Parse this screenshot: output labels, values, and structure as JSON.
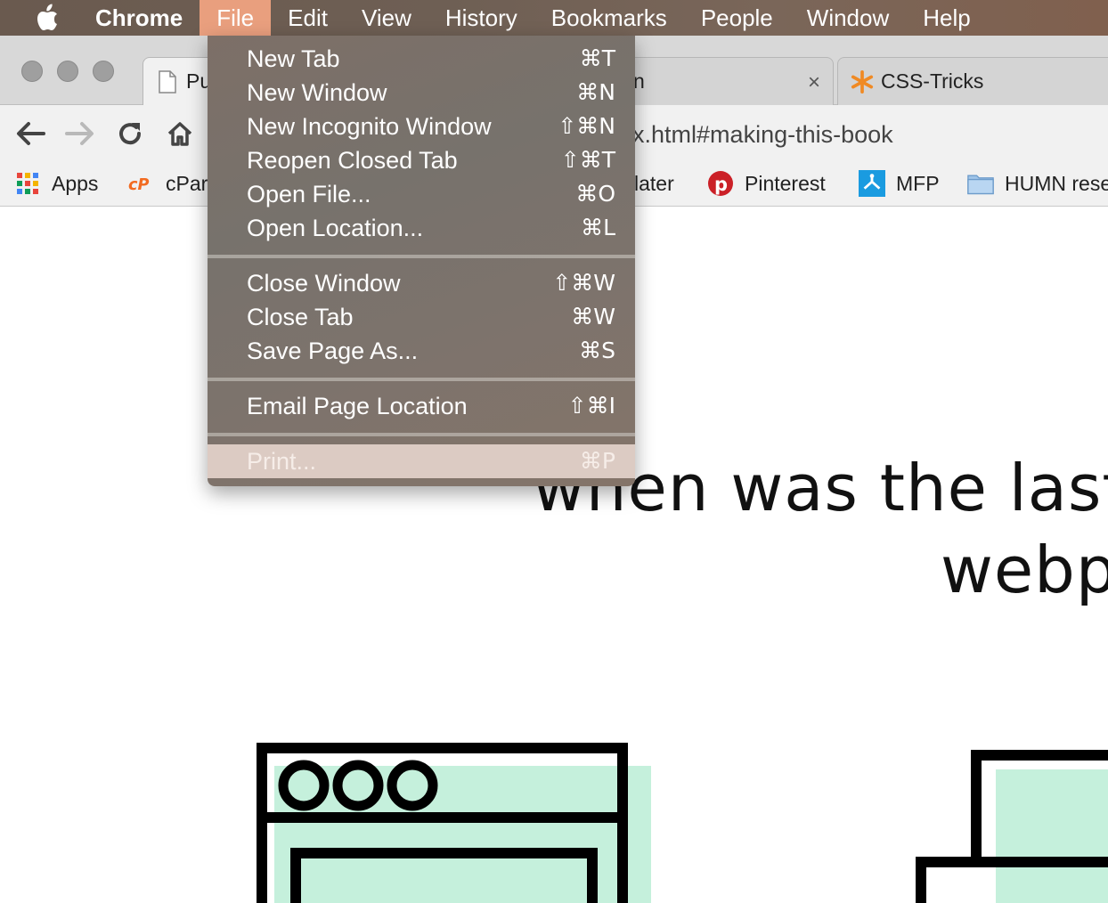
{
  "menubar": {
    "app_name": "Chrome",
    "items": [
      "File",
      "Edit",
      "View",
      "History",
      "Bookmarks",
      "People",
      "Window",
      "Help"
    ]
  },
  "tabs": [
    {
      "title": "Pu",
      "favicon": "document-icon"
    },
    {
      "title": "n",
      "close": "×"
    },
    {
      "title": "CSS-Tricks",
      "favicon": "css-tricks-star-icon"
    }
  ],
  "omnibox": {
    "url": "dex.html#making-this-book"
  },
  "bookmarks": [
    {
      "label": "Apps",
      "icon": "apps-grid-icon"
    },
    {
      "label": "cPar",
      "icon": "cpanel-icon"
    },
    {
      "label": "later",
      "icon": ""
    },
    {
      "label": "Pinterest",
      "icon": "pinterest-icon"
    },
    {
      "label": "MFP",
      "icon": "mfp-icon"
    },
    {
      "label": "HUMN rese",
      "icon": "folder-icon"
    }
  ],
  "file_menu": {
    "groups": [
      [
        {
          "label": "New Tab",
          "shortcut": "⌘T"
        },
        {
          "label": "New Window",
          "shortcut": "⌘N"
        },
        {
          "label": "New Incognito Window",
          "shortcut": "⇧⌘N"
        },
        {
          "label": "Reopen Closed Tab",
          "shortcut": "⇧⌘T"
        },
        {
          "label": "Open File...",
          "shortcut": "⌘O"
        },
        {
          "label": "Open Location...",
          "shortcut": "⌘L"
        }
      ],
      [
        {
          "label": "Close Window",
          "shortcut": "⇧⌘W"
        },
        {
          "label": "Close Tab",
          "shortcut": "⌘W"
        },
        {
          "label": "Save Page As...",
          "shortcut": "⌘S"
        }
      ],
      [
        {
          "label": "Email Page Location",
          "shortcut": "⇧⌘I"
        }
      ],
      [
        {
          "label": "Print...",
          "shortcut": "⌘P",
          "disabled": true
        }
      ]
    ]
  },
  "page": {
    "headline_line1": "when was the last t",
    "headline_line2": "webp"
  },
  "colors": {
    "menu_active": "#e99f7e",
    "illustration_mint": "#c5f0dc",
    "illustration_stroke": "#000000"
  }
}
